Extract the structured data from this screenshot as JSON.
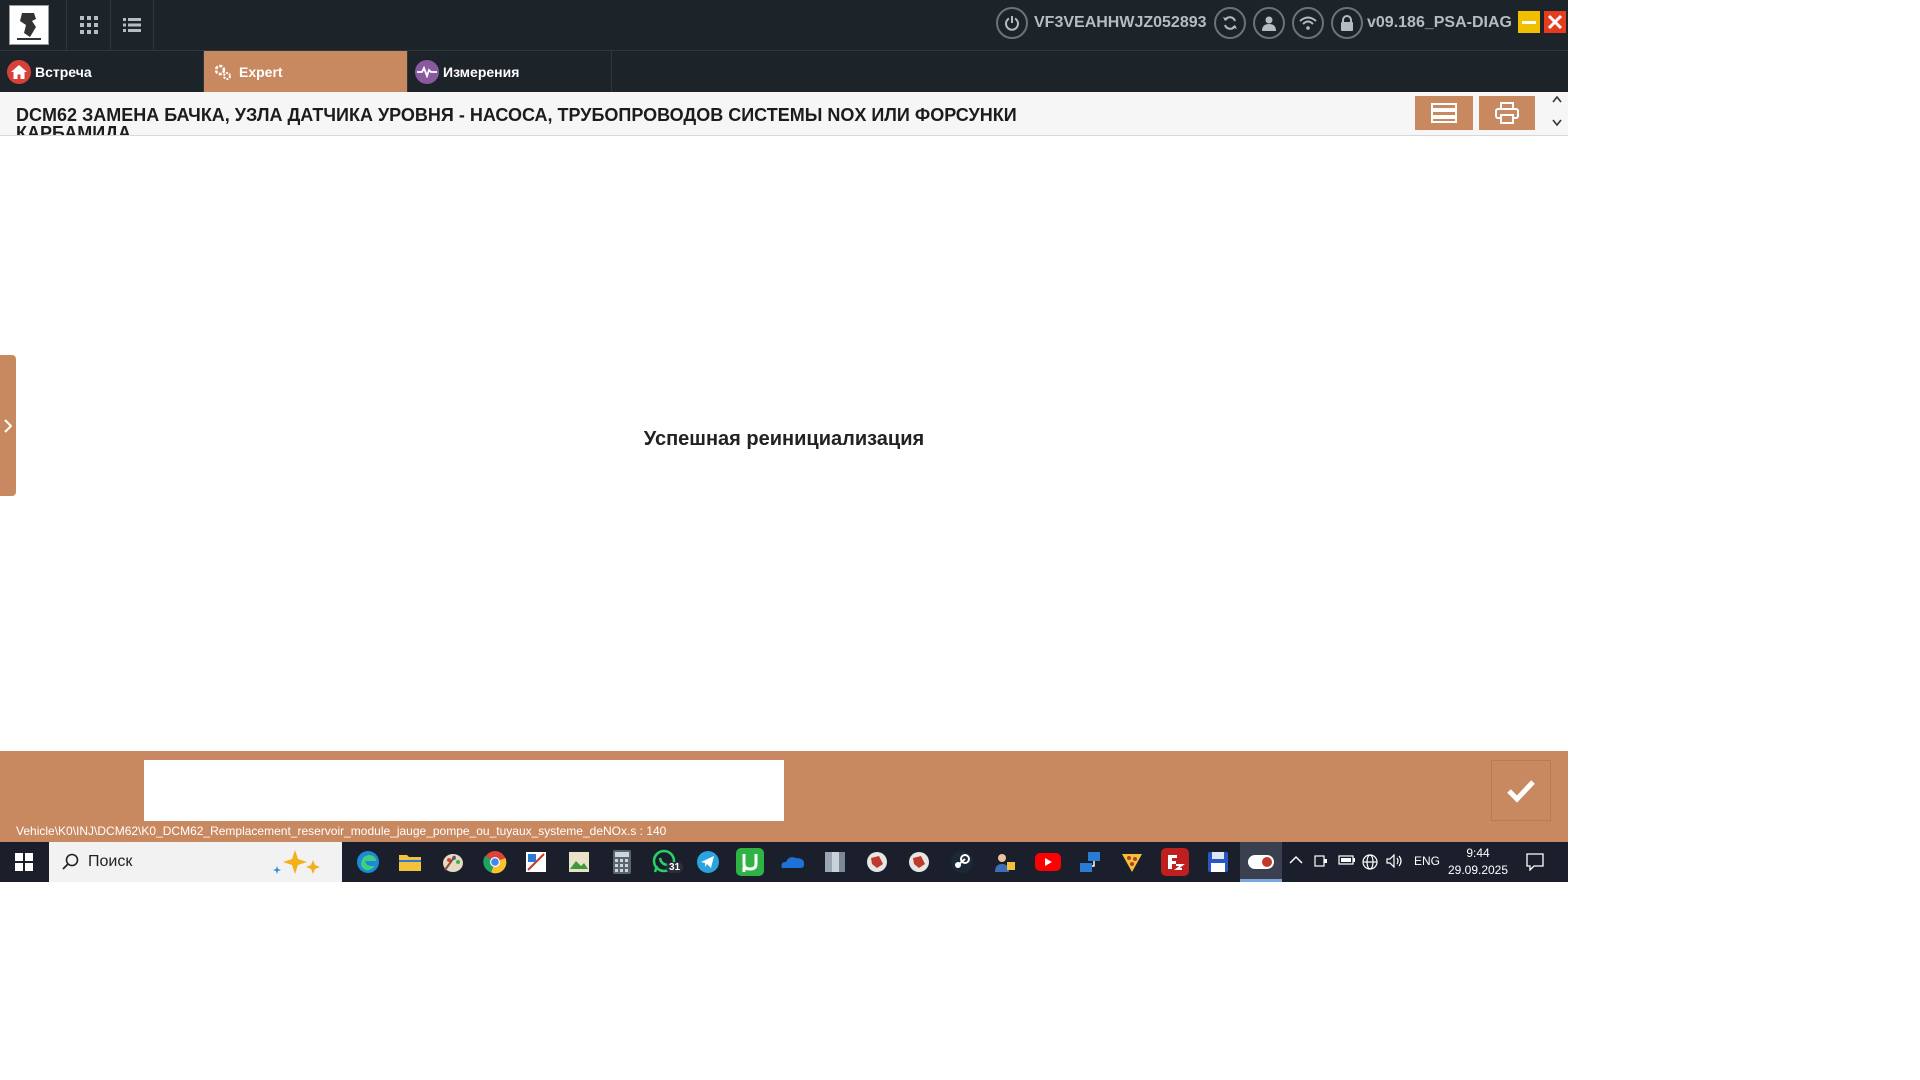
{
  "app": {
    "vin": "VF3VEAHHWJZ052893",
    "version": "v09.186_PSA-DIAG"
  },
  "tabs": [
    {
      "label": "Встреча",
      "active": false
    },
    {
      "label": "Expert",
      "active": true
    },
    {
      "label": "Измерения",
      "active": false
    }
  ],
  "page": {
    "title": "DCM62 ЗАМЕНА БАЧКА, УЗЛА ДАТЧИКА УРОВНЯ - НАСОСА, ТРУБОПРОВОДОВ СИСТЕМЫ NOX ИЛИ ФОРСУНКИ КАРБАМИДА",
    "message": "Успешная реинициализация"
  },
  "bottom": {
    "input_value": "",
    "path": "Vehicle\\K0\\INJ\\DCM62\\K0_DCM62_Remplacement_reservoir_module_jauge_pompe_ou_tuyaux_systeme_deNOx.s : 140"
  },
  "taskbar": {
    "search_placeholder": "Поиск",
    "whatsapp_badge": "31",
    "language": "ENG",
    "time": "9:44",
    "date": "29.09.2025"
  },
  "colors": {
    "accent": "#c88960",
    "topbar": "#1c2329",
    "taskbar": "#1a1f2b"
  }
}
